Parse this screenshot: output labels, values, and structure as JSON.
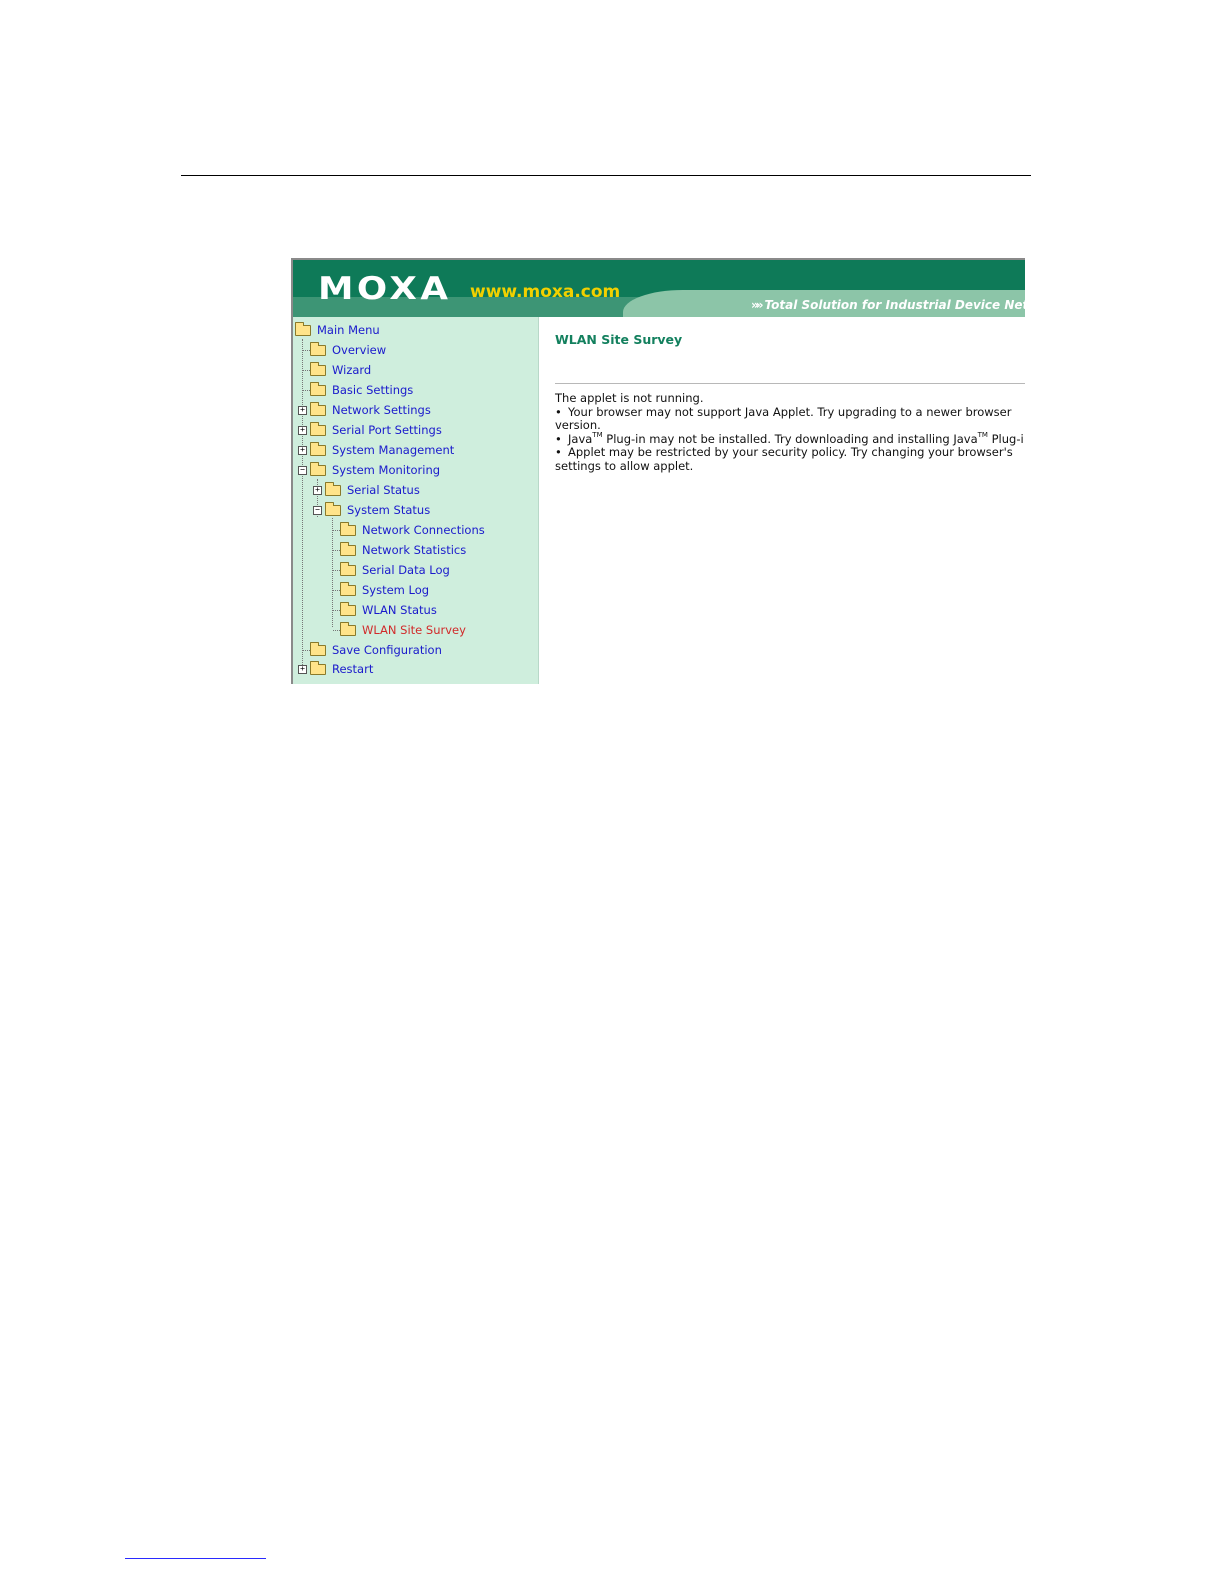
{
  "banner": {
    "logo": "MOXA",
    "url": "www.moxa.com",
    "tagline_arrows": "»»",
    "tagline": "Total Solution for Industrial Device Network"
  },
  "menu": {
    "root": "Main Menu",
    "items": [
      {
        "label": "Overview"
      },
      {
        "label": "Wizard"
      },
      {
        "label": "Basic Settings"
      },
      {
        "label": "Network Settings"
      },
      {
        "label": "Serial Port Settings"
      },
      {
        "label": "System Management"
      },
      {
        "label": "System Monitoring"
      },
      {
        "label": "Serial Status"
      },
      {
        "label": "System Status"
      },
      {
        "label": "Network Connections"
      },
      {
        "label": "Network Statistics"
      },
      {
        "label": "Serial Data Log"
      },
      {
        "label": "System Log"
      },
      {
        "label": "WLAN Status"
      },
      {
        "label": "WLAN Site Survey"
      },
      {
        "label": "Save Configuration"
      },
      {
        "label": "Restart"
      }
    ],
    "active_item": "WLAN Site Survey"
  },
  "content": {
    "title": "WLAN Site Survey",
    "intro": "The applet is not running.",
    "bullet1_a": "Your browser may not support Java Applet. Try upgrading to a newer browser",
    "bullet1_b": "version.",
    "bullet2_a": "Java",
    "bullet2_tm1": "TM",
    "bullet2_b": " Plug-in may not be installed. Try downloading and installing Java",
    "bullet2_tm2": "TM",
    "bullet2_c": " Plug-i",
    "bullet3_a": "Applet may be restricted by your security policy. Try changing your browser's",
    "bullet3_b": "settings to allow applet."
  },
  "colors": {
    "banner": "#0e7a58",
    "sidebar": "#cfeedd",
    "link": "#1a1acc",
    "active_link": "#d12a2a",
    "title": "#13805e",
    "logo_url": "#f2d000"
  }
}
